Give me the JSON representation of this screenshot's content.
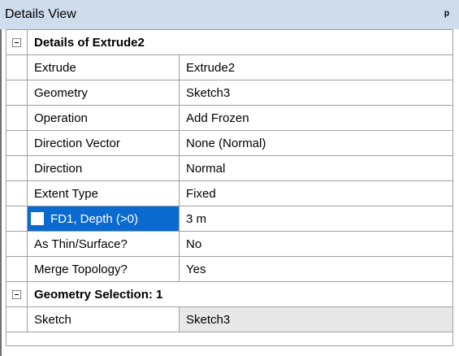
{
  "panel": {
    "title": "Details View",
    "pin_glyph": "ᵖ"
  },
  "sections": [
    {
      "header": "Details of Extrude2",
      "rows": [
        {
          "name": "Extrude",
          "value": "Extrude2"
        },
        {
          "name": "Geometry",
          "value": "Sketch3"
        },
        {
          "name": "Operation",
          "value": "Add Frozen"
        },
        {
          "name": "Direction Vector",
          "value": "None (Normal)"
        },
        {
          "name": "Direction",
          "value": "Normal"
        },
        {
          "name": "Extent Type",
          "value": "Fixed"
        },
        {
          "name": "FD1,  Depth (>0)",
          "value": "3 m",
          "selected": true,
          "has_checkbox": true
        },
        {
          "name": "As Thin/Surface?",
          "value": "No"
        },
        {
          "name": "Merge Topology?",
          "value": "Yes"
        }
      ]
    },
    {
      "header": "Geometry Selection: 1",
      "rows": [
        {
          "name": "Sketch",
          "value": "Sketch3"
        }
      ]
    }
  ],
  "colors": {
    "titlebar": "#cfdcec",
    "selection": "#0a6ad0",
    "grid_line": "#a0a0a0"
  }
}
